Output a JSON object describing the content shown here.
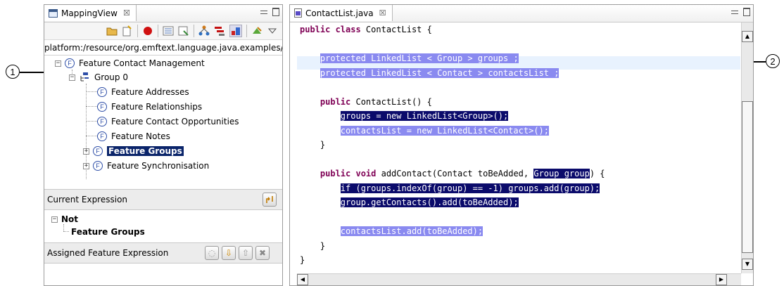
{
  "callouts": {
    "left": "1",
    "right": "2"
  },
  "mapping_view": {
    "tab_title": "MappingView",
    "tab_close": "☒",
    "path_text": "platform:/resource/org.emftext.language.java.examples/",
    "tree": [
      {
        "label": "Feature Contact Management",
        "icon": "feature-icon",
        "expander": "−"
      },
      {
        "label": "Group 0",
        "icon": "group-icon",
        "expander": "−"
      },
      {
        "label": "Feature Addresses",
        "icon": "feature-icon"
      },
      {
        "label": "Feature Relationships",
        "icon": "feature-icon"
      },
      {
        "label": "Feature Contact Opportunities",
        "icon": "feature-icon"
      },
      {
        "label": "Feature Notes",
        "icon": "feature-icon"
      },
      {
        "label": "Feature Groups",
        "icon": "feature-icon",
        "expander": "+",
        "selected": true
      },
      {
        "label": "Feature Synchronisation",
        "icon": "feature-icon",
        "expander": "+"
      }
    ],
    "current_expression_label": "Current Expression",
    "expression": {
      "root": "Not",
      "expander": "−",
      "child": "Feature Groups"
    },
    "assigned_label": "Assigned Feature Expression",
    "feature_icon_letter": "F"
  },
  "editor": {
    "tab_title": "ContactList.java",
    "tab_close": "☒",
    "lines": [
      {
        "parts": [
          {
            "t": "public class ",
            "c": "kw"
          },
          {
            "t": "ContactList {"
          }
        ]
      },
      {
        "parts": []
      },
      {
        "parts": [
          {
            "t": "    "
          },
          {
            "t": "protected LinkedList < Group > groups ;",
            "c": "hl-light"
          }
        ]
      },
      {
        "parts": [
          {
            "t": "    "
          },
          {
            "t": "protected LinkedList < Contact > contactsList ;",
            "c": "hl-light"
          }
        ]
      },
      {
        "parts": []
      },
      {
        "parts": [
          {
            "t": "    "
          },
          {
            "t": "public ",
            "c": "kw"
          },
          {
            "t": "ContactList() {"
          }
        ]
      },
      {
        "parts": [
          {
            "t": "        "
          },
          {
            "t": "groups = new LinkedList<Group>();",
            "c": "hl-dark"
          }
        ]
      },
      {
        "parts": [
          {
            "t": "        "
          },
          {
            "t": "contactsList = new LinkedList<Contact>();",
            "c": "hl-light"
          }
        ]
      },
      {
        "parts": [
          {
            "t": "    }"
          }
        ]
      },
      {
        "parts": []
      },
      {
        "parts": [
          {
            "t": "    "
          },
          {
            "t": "public void ",
            "c": "kw"
          },
          {
            "t": "addContact(Contact toBeAdded, "
          },
          {
            "t": "Group group",
            "c": "hl-dark"
          },
          {
            "t": ") {"
          }
        ]
      },
      {
        "parts": [
          {
            "t": "        "
          },
          {
            "t": "if (groups.indexOf(group) == -1) groups.add(group);",
            "c": "hl-dark"
          }
        ]
      },
      {
        "parts": [
          {
            "t": "        "
          },
          {
            "t": "group.getContacts().add(toBeAdded);",
            "c": "hl-dark"
          }
        ]
      },
      {
        "parts": []
      },
      {
        "parts": [
          {
            "t": "        "
          },
          {
            "t": "contactsList.add(toBeAdded);",
            "c": "hl-light"
          }
        ]
      },
      {
        "parts": [
          {
            "t": "    }"
          }
        ]
      },
      {
        "parts": [
          {
            "t": "}"
          }
        ]
      }
    ]
  },
  "colors": {
    "selection": "#0a246a",
    "highlight_dark": "#0b0b6b",
    "highlight_light": "#8a8af0",
    "keyword": "#7f0055"
  }
}
